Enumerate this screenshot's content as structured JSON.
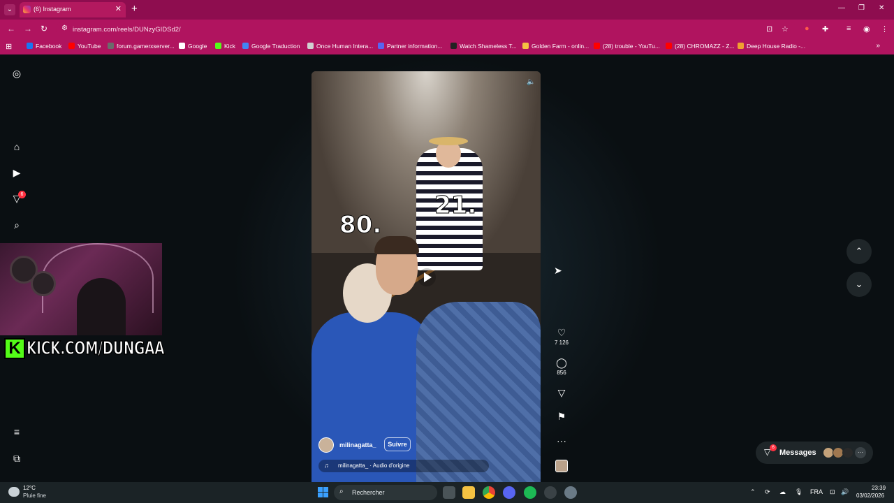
{
  "browser": {
    "tab_title": "(6) Instagram",
    "url": "instagram.com/reels/DUNzyGIDSd2/",
    "bookmarks": [
      {
        "label": "Facebook",
        "color": "#1877f2"
      },
      {
        "label": "YouTube",
        "color": "#ff0000"
      },
      {
        "label": "forum.gamerxserver...",
        "color": "#6b6b6b"
      },
      {
        "label": "Google",
        "color": "#ffffff"
      },
      {
        "label": "Kick",
        "color": "#53fc18"
      },
      {
        "label": "Google Traduction",
        "color": "#4285f4"
      },
      {
        "label": "Once Human Intera...",
        "color": "#d0d0d0"
      },
      {
        "label": "Partner information...",
        "color": "#5865f2"
      },
      {
        "label": "Watch Shameless T...",
        "color": "#222222"
      },
      {
        "label": "Golden Farm - onlin...",
        "color": "#f5c242"
      },
      {
        "label": "(28) trouble - YouTu...",
        "color": "#ff0000"
      },
      {
        "label": "(28) CHROMAZZ - Z...",
        "color": "#ff0000"
      },
      {
        "label": "Deep House Radio -...",
        "color": "#f0a030"
      }
    ]
  },
  "sidebar": {
    "notification_count": "6"
  },
  "stream_overlay": {
    "kick_text": "KICK.COM/DUNGAA"
  },
  "reel": {
    "overlay_left": "80.",
    "overlay_right": "21.",
    "username": "milinagatta_",
    "follow_label": "Suivre",
    "audio": "milinagatta_ · Audio d'origine",
    "likes": "7 126",
    "comments": "856"
  },
  "messages": {
    "label": "Messages",
    "badge": "6"
  },
  "taskbar": {
    "temperature": "12°C",
    "weather": "Pluie fine",
    "search_placeholder": "Rechercher",
    "language": "FRA",
    "time": "23:39",
    "date": "03/02/2026"
  }
}
